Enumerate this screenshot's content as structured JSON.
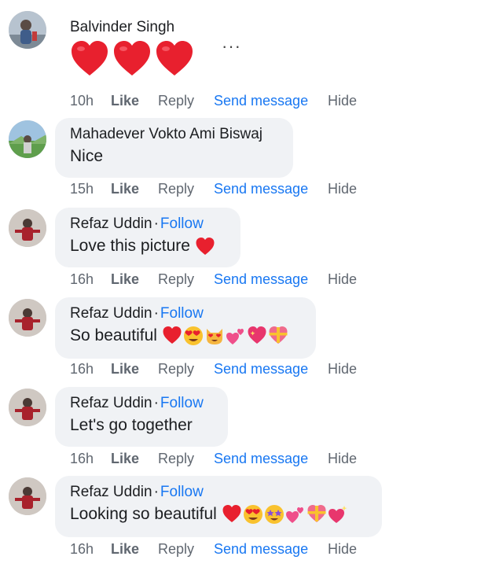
{
  "comments": [
    {
      "author": "Balvinder Singh",
      "follow": "",
      "text": "",
      "emojis": [
        "red-heart",
        "red-heart",
        "red-heart"
      ],
      "time": "10h",
      "like": "Like",
      "reply": "Reply",
      "send_message": "Send message",
      "hide": "Hide",
      "more": "···"
    },
    {
      "author": "Mahadever Vokto Ami Biswaj",
      "follow": "",
      "text": "Nice",
      "emojis": [],
      "time": "15h",
      "like": "Like",
      "reply": "Reply",
      "send_message": "Send message",
      "hide": "Hide"
    },
    {
      "author": "Refaz Uddin",
      "separator": "·",
      "follow": "Follow",
      "text": "Love this picture",
      "emojis": [
        "red-heart"
      ],
      "time": "16h",
      "like": "Like",
      "reply": "Reply",
      "send_message": "Send message",
      "hide": "Hide"
    },
    {
      "author": "Refaz Uddin",
      "separator": "·",
      "follow": "Follow",
      "text": "So beautiful",
      "emojis": [
        "red-heart",
        "heart-eyes-face",
        "heart-eyes-cat",
        "two-hearts",
        "sparkling-heart",
        "heart-with-ribbon"
      ],
      "time": "16h",
      "like": "Like",
      "reply": "Reply",
      "send_message": "Send message",
      "hide": "Hide"
    },
    {
      "author": "Refaz Uddin",
      "separator": "·",
      "follow": "Follow",
      "text": "Let's go together",
      "emojis": [],
      "time": "16h",
      "like": "Like",
      "reply": "Reply",
      "send_message": "Send message",
      "hide": "Hide"
    },
    {
      "author": "Refaz Uddin",
      "separator": "·",
      "follow": "Follow",
      "text": "Looking so beautiful",
      "emojis": [
        "red-heart",
        "heart-eyes-face",
        "star-struck-face",
        "two-hearts",
        "heart-with-ribbon",
        "sparkling-heart"
      ],
      "time": "16h",
      "like": "Like",
      "reply": "Reply",
      "send_message": "Send message",
      "hide": "Hide"
    }
  ],
  "colors": {
    "bubble": "#f0f2f5",
    "link": "#1877f2",
    "meta": "#606770",
    "heart": "#e8202e"
  }
}
